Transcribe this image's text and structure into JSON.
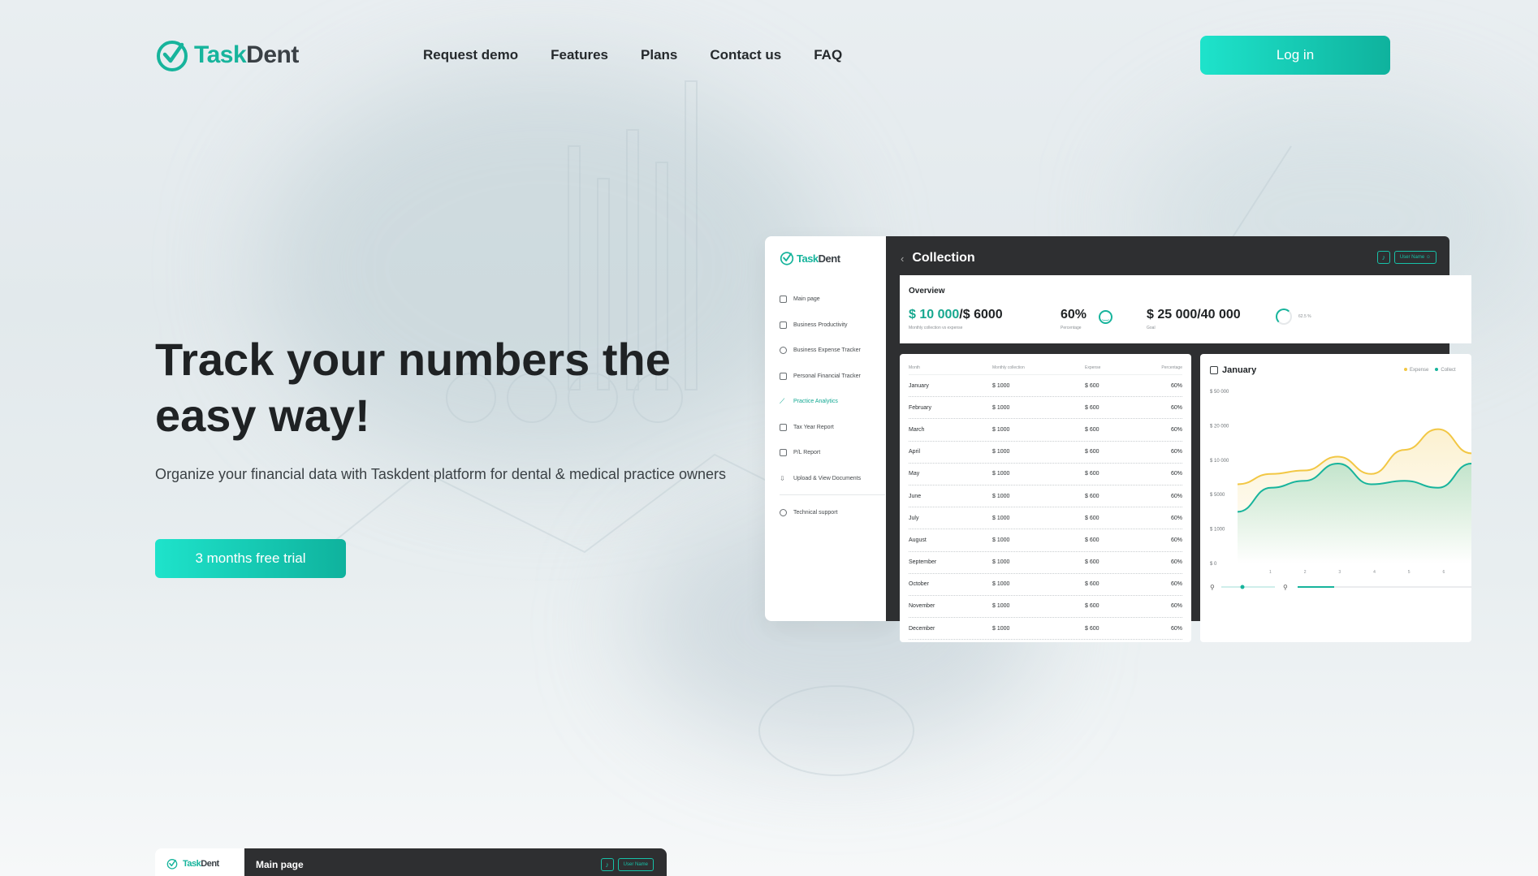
{
  "brand": {
    "name_a": "Task",
    "name_b": "Dent",
    "accent": "#17b49c"
  },
  "nav": {
    "items": [
      "Request demo",
      "Features",
      "Plans",
      "Contact us",
      "FAQ"
    ],
    "login": "Log in"
  },
  "hero": {
    "title": "Track your numbers the easy way!",
    "subtitle": "Organize your financial data with Taskdent platform for dental & medical practice owners",
    "cta": "3 months free trial"
  },
  "dashboard": {
    "sidebar": [
      {
        "label": "Main page",
        "icon": "home-icon",
        "active": false
      },
      {
        "label": "Business Productivity",
        "icon": "briefcase-icon",
        "active": false
      },
      {
        "label": "Business Expense Tracker",
        "icon": "refresh-icon",
        "active": false
      },
      {
        "label": "Personal Financial Tracker",
        "icon": "bank-icon",
        "active": false
      },
      {
        "label": "Practice Analytics",
        "icon": "trend-icon",
        "active": true
      },
      {
        "label": "Tax Year Report",
        "icon": "document-icon",
        "active": false
      },
      {
        "label": "P/L Report",
        "icon": "report-icon",
        "active": false
      },
      {
        "label": "Upload & View Documents",
        "icon": "upload-icon",
        "active": false
      },
      {
        "label": "Technical support",
        "icon": "help-icon",
        "active": false
      }
    ],
    "header": {
      "title": "Collection",
      "user": "User Name"
    },
    "overview": {
      "title": "Overview",
      "collection_a": "$ 10 000",
      "collection_b": "/$ 6000",
      "collection_caption": "Monthly collection vs expense",
      "percentage": "60%",
      "percentage_caption": "Percentage",
      "goal": "$ 25 000/40 000",
      "goal_caption": "Goal",
      "goal_pct": "62.5 %"
    },
    "table": {
      "headers": [
        "Month",
        "Monthly collection",
        "Expense",
        "Percentage"
      ],
      "rows": [
        [
          "January",
          "$ 1000",
          "$ 600",
          "60%"
        ],
        [
          "February",
          "$ 1000",
          "$ 600",
          "60%"
        ],
        [
          "March",
          "$ 1000",
          "$ 600",
          "60%"
        ],
        [
          "April",
          "$ 1000",
          "$ 600",
          "60%"
        ],
        [
          "May",
          "$ 1000",
          "$ 600",
          "60%"
        ],
        [
          "June",
          "$ 1000",
          "$ 600",
          "60%"
        ],
        [
          "July",
          "$ 1000",
          "$ 600",
          "60%"
        ],
        [
          "August",
          "$ 1000",
          "$ 600",
          "60%"
        ],
        [
          "September",
          "$ 1000",
          "$ 600",
          "60%"
        ],
        [
          "October",
          "$ 1000",
          "$ 600",
          "60%"
        ],
        [
          "November",
          "$ 1000",
          "$ 600",
          "60%"
        ],
        [
          "December",
          "$ 1000",
          "$ 600",
          "60%"
        ]
      ]
    },
    "chart": {
      "title": "January",
      "legend": [
        {
          "name": "Expense",
          "color": "#f2c744"
        },
        {
          "name": "Collect",
          "color": "#17b49c"
        }
      ]
    }
  },
  "chart_data": {
    "type": "area",
    "title": "January",
    "y_ticks": [
      "$ 50 000",
      "$ 20 000",
      "$ 10 000",
      "$ 5000",
      "$ 1000",
      "$ 0"
    ],
    "x": [
      1,
      2,
      3,
      4,
      5,
      6
    ],
    "series": [
      {
        "name": "Expense",
        "color": "#f2c744",
        "values": [
          2.3,
          2.6,
          2.7,
          3.1,
          2.6,
          3.3,
          3.9,
          3.2
        ]
      },
      {
        "name": "Collect",
        "color": "#17b49c",
        "values": [
          1.5,
          2.2,
          2.4,
          2.9,
          2.3,
          2.4,
          2.2,
          2.9
        ]
      }
    ]
  },
  "preview": {
    "title": "Main page",
    "user": "User Name"
  }
}
